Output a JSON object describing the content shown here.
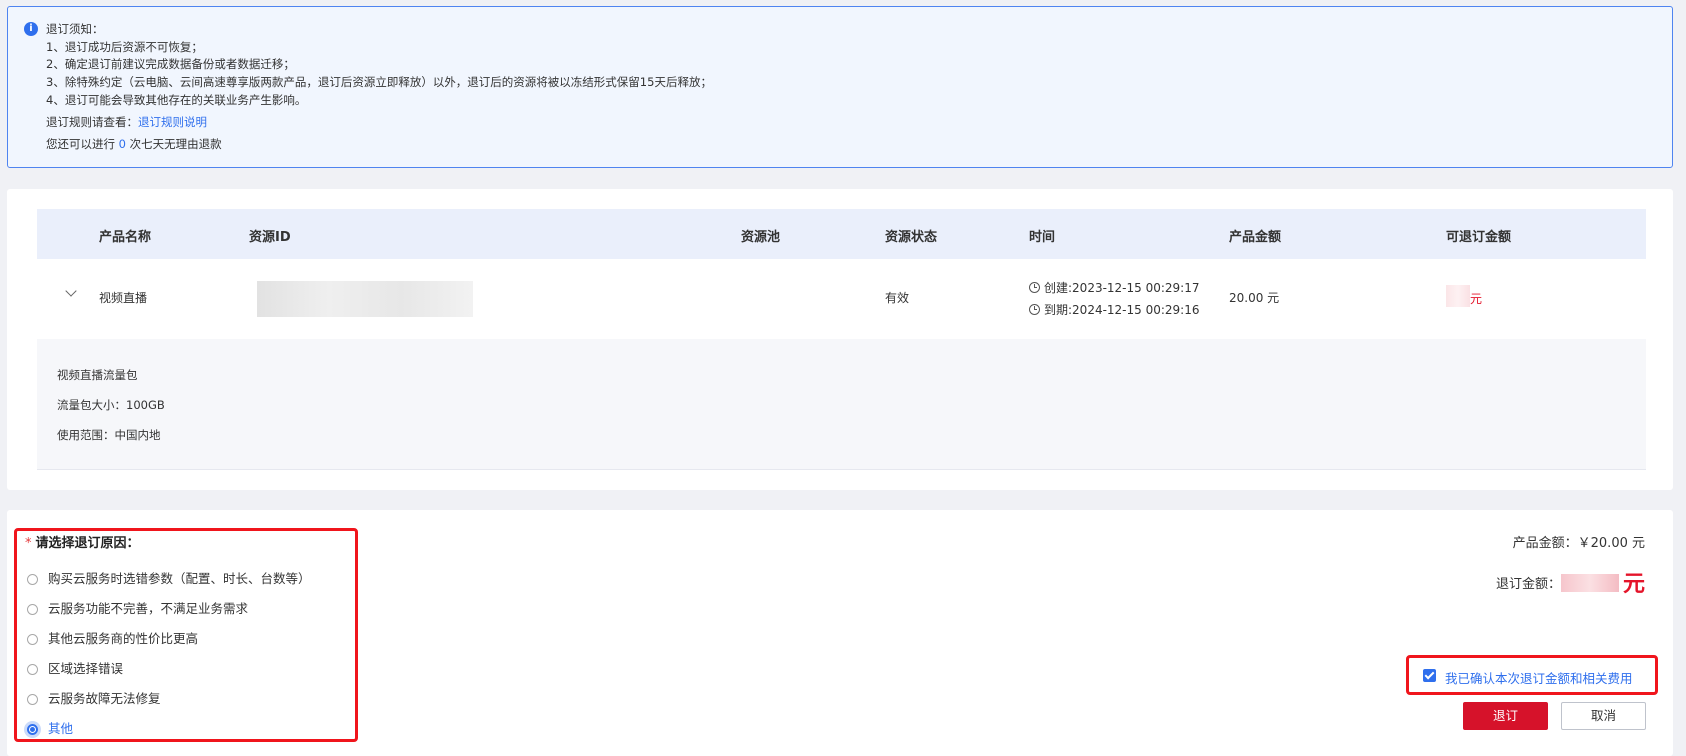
{
  "notice": {
    "title": "退订须知：",
    "items": [
      "1、退订成功后资源不可恢复；",
      "2、确定退订前建议完成数据备份或者数据迁移；",
      "3、除特殊约定（云电脑、云间高速尊享版两款产品，退订后资源立即释放）以外，退订后的资源将被以冻结形式保留15天后释放；",
      "4、退订可能会导致其他存在的关联业务产生影响。"
    ],
    "rules_prefix": "退订规则请查看：",
    "rules_link": "退订规则说明",
    "refund_prefix": "您还可以进行",
    "refund_count": "0",
    "refund_suffix": "次七天无理由退款"
  },
  "table": {
    "headers": [
      "产品名称",
      "资源ID",
      "资源池",
      "资源状态",
      "时间",
      "产品金额",
      "可退订金额"
    ],
    "row": {
      "product": "视频直播",
      "status": "有效",
      "created": "创建:2023-12-15 00:29:17",
      "expires": "到期:2024-12-15 00:29:16",
      "amount": "20.00 元",
      "refundable_unit": "元"
    },
    "detail": {
      "name": "视频直播流量包",
      "size": "流量包大小：100GB",
      "scope": "使用范围：中国内地"
    }
  },
  "reason": {
    "required_mark": "*",
    "title": "请选择退订原因：",
    "options": [
      "购买云服务时选错参数（配置、时长、台数等）",
      "云服务功能不完善，不满足业务需求",
      "其他云服务商的性价比更高",
      "区域选择错误",
      "云服务故障无法修复",
      "其他"
    ],
    "selected_index": 5
  },
  "summary": {
    "product_amount": "产品金额：￥20.00 元",
    "refund_label": "退订金额：",
    "refund_unit": "元"
  },
  "confirm_text": "我已确认本次退订金额和相关费用",
  "buttons": {
    "unsubscribe": "退订",
    "cancel": "取消"
  },
  "colors": {
    "accent": "#2f6fed",
    "danger": "#d6122a",
    "highlight_border": "#f0151c"
  }
}
